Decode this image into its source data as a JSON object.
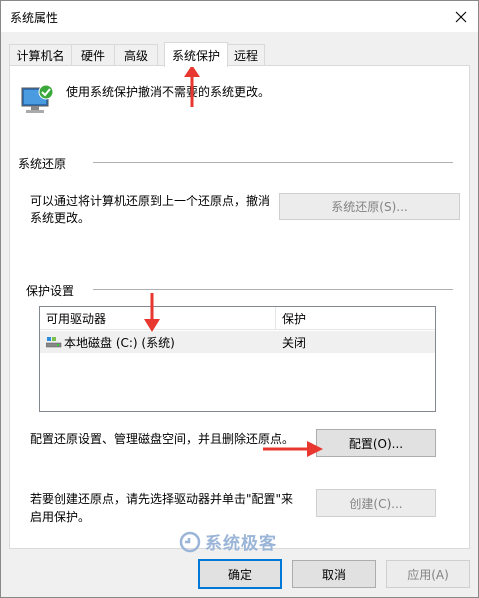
{
  "window": {
    "title": "系统属性"
  },
  "tabs": [
    {
      "label": "计算机名"
    },
    {
      "label": "硬件"
    },
    {
      "label": "高级"
    },
    {
      "label": "系统保护"
    },
    {
      "label": "远程"
    }
  ],
  "intro": {
    "text": "使用系统保护撤消不需要的系统更改。"
  },
  "restore": {
    "group_label": "系统还原",
    "desc_line1": "可以通过将计算机还原到上一个还原点，撤消",
    "desc_line2": "系统更改。",
    "button_label": "系统还原(S)..."
  },
  "protection": {
    "group_label": "保护设置",
    "columns": [
      "可用驱动器",
      "保护"
    ],
    "rows": [
      {
        "drive": "本地磁盘 (C:) (系统)",
        "status": "关闭"
      }
    ],
    "config_desc": "配置还原设置、管理磁盘空间，并且删除还原点。",
    "config_button": "配置(O)...",
    "create_desc_line1": "若要创建还原点，请先选择驱动器并单击\"配置\"来",
    "create_desc_line2": "启用保护。",
    "create_button": "创建(C)..."
  },
  "footer": {
    "ok": "确定",
    "cancel": "取消",
    "apply": "应用(A)"
  },
  "watermark": {
    "text": "系统极客"
  },
  "colors": {
    "accent": "#0078d7",
    "arrow": "#e8372f"
  }
}
